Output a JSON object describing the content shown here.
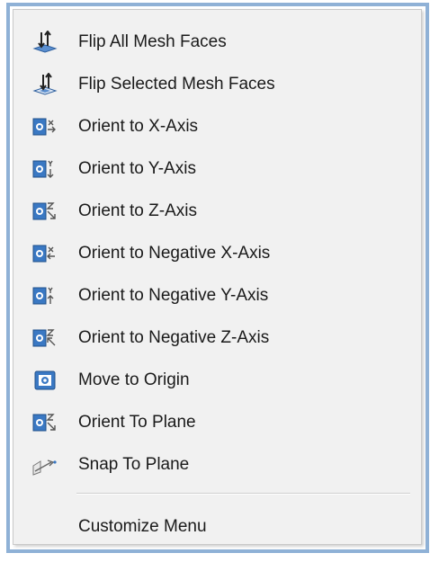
{
  "menu": {
    "items": [
      {
        "label": "Flip All Mesh Faces",
        "icon": "flip-all-mesh-faces-icon"
      },
      {
        "label": "Flip Selected Mesh Faces",
        "icon": "flip-selected-mesh-faces-icon"
      },
      {
        "label": "Orient to X-Axis",
        "icon": "orient-x-axis-icon"
      },
      {
        "label": "Orient to Y-Axis",
        "icon": "orient-y-axis-icon"
      },
      {
        "label": "Orient to Z-Axis",
        "icon": "orient-z-axis-icon"
      },
      {
        "label": "Orient to Negative X-Axis",
        "icon": "orient-negative-x-axis-icon"
      },
      {
        "label": "Orient to Negative Y-Axis",
        "icon": "orient-negative-y-axis-icon"
      },
      {
        "label": "Orient to Negative Z-Axis",
        "icon": "orient-negative-z-axis-icon"
      },
      {
        "label": "Move to Origin",
        "icon": "move-to-origin-icon"
      },
      {
        "label": "Orient To Plane",
        "icon": "orient-to-plane-icon"
      },
      {
        "label": "Snap To Plane",
        "icon": "snap-to-plane-icon"
      }
    ],
    "footer": {
      "label": "Customize Menu"
    }
  },
  "colors": {
    "window_border": "#8fb1d6",
    "menu_background": "#f1f1f1",
    "icon_blue": "#3a78c3",
    "icon_dark": "#333333",
    "text": "#1a1a1a"
  }
}
